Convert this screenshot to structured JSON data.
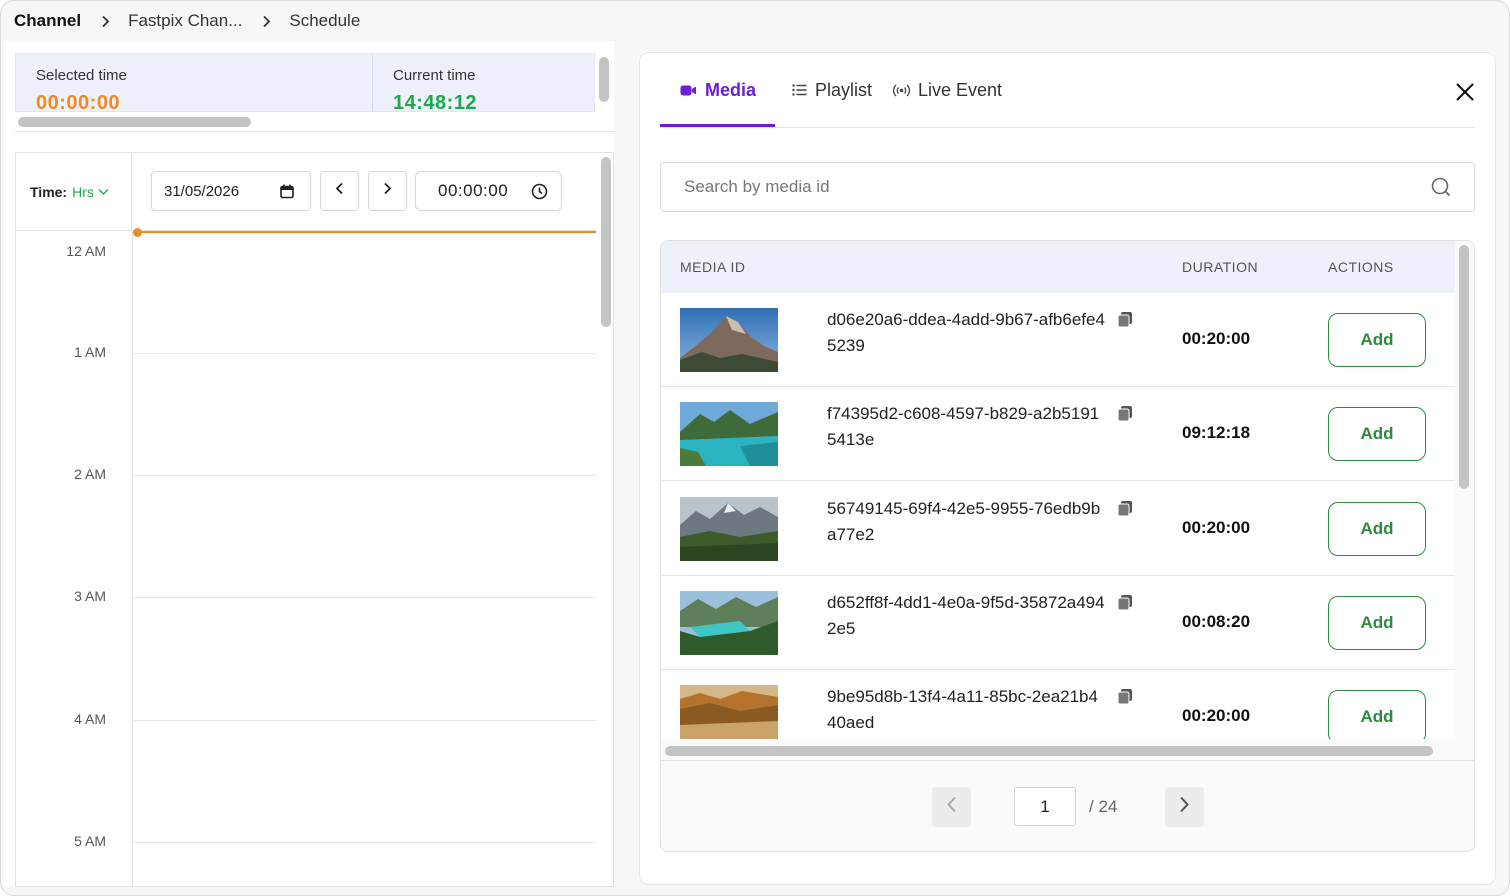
{
  "breadcrumb": {
    "items": [
      "Channel",
      "Fastpix Chan...",
      "Schedule"
    ]
  },
  "time_summary": {
    "selected_label": "Selected time",
    "selected_value": "00:00:00",
    "current_label": "Current time",
    "current_value": "14:48:12"
  },
  "calendar": {
    "time_label": "Time:",
    "time_unit": "Hrs",
    "date_value": "31/05/2026",
    "time_value": "00:00:00",
    "hours": [
      "12 AM",
      "1 AM",
      "2 AM",
      "3 AM",
      "4 AM",
      "5 AM"
    ]
  },
  "panel": {
    "tabs": [
      {
        "label": "Media",
        "icon": "video-camera-icon",
        "active": true
      },
      {
        "label": "Playlist",
        "icon": "list-icon",
        "active": false
      },
      {
        "label": "Live Event",
        "icon": "broadcast-icon",
        "active": false
      }
    ],
    "search_placeholder": "Search by media id",
    "table": {
      "headers": {
        "media_id": "MEDIA ID",
        "duration": "DURATION",
        "actions": "ACTIONS"
      },
      "rows": [
        {
          "id": "d06e20a6-ddea-4add-9b67-afb6efe45239",
          "duration": "00:20:00",
          "action": "Add",
          "thumb": "mountain-peak"
        },
        {
          "id": "f74395d2-c608-4597-b829-a2b51915413e",
          "duration": "09:12:18",
          "action": "Add",
          "thumb": "turquoise-lake"
        },
        {
          "id": "56749145-69f4-42e5-9955-76edb9ba77e2",
          "duration": "00:20:00",
          "action": "Add",
          "thumb": "alpine-meadow"
        },
        {
          "id": "d652ff8f-4dd1-4e0a-9f5d-35872a4942e5",
          "duration": "00:08:20",
          "action": "Add",
          "thumb": "valley-lake"
        },
        {
          "id": "9be95d8b-13f4-4a11-85bc-2ea21b440aed",
          "duration": "00:20:00",
          "action": "Add",
          "thumb": "autumn-forest"
        }
      ]
    },
    "pagination": {
      "current": "1",
      "total": "/ 24"
    }
  },
  "colors": {
    "accent": "#6a1fd6",
    "selected_time": "#f08a24",
    "current_time": "#1fa84f",
    "add_button": "#2e8b3e"
  }
}
